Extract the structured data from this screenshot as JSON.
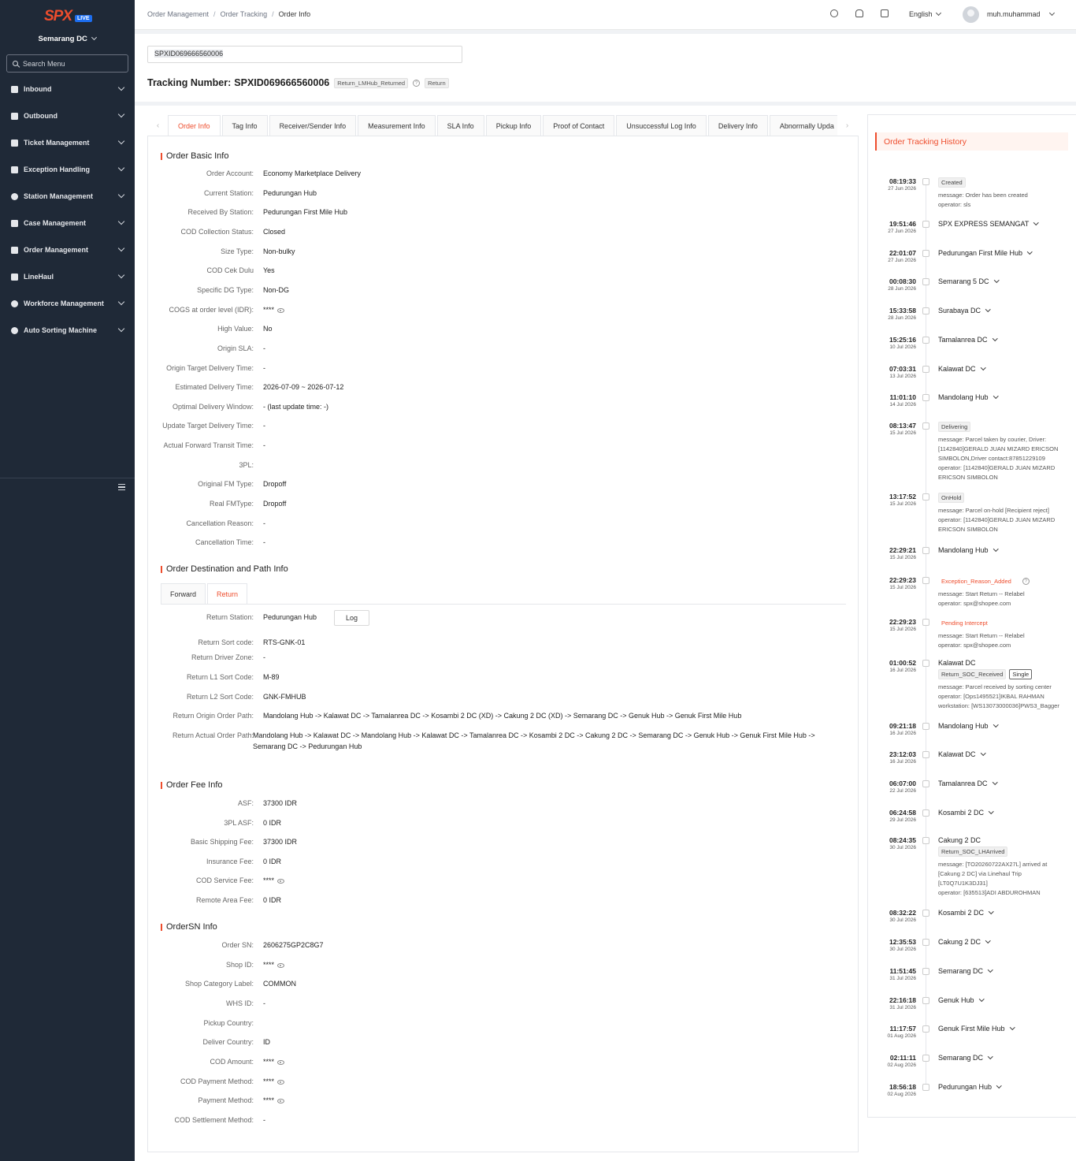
{
  "brand": {
    "logo": "SPX",
    "badge": "LIVE"
  },
  "sidebar": {
    "station": "Semarang DC",
    "search_placeholder": "Search Menu",
    "items": [
      {
        "label": "Inbound"
      },
      {
        "label": "Outbound"
      },
      {
        "label": "Ticket Management"
      },
      {
        "label": "Exception Handling"
      },
      {
        "label": "Station Management"
      },
      {
        "label": "Case Management"
      },
      {
        "label": "Order Management"
      },
      {
        "label": "LineHaul"
      },
      {
        "label": "Workforce Management"
      },
      {
        "label": "Auto Sorting Machine"
      }
    ]
  },
  "topbar": {
    "breadcrumb": [
      "Order Management",
      "Order Tracking",
      "Order Info"
    ],
    "language": "English",
    "username": "muh.muhammad"
  },
  "header": {
    "tracking_input": "SPXID069666560006",
    "title_prefix": "Tracking Number:",
    "tracking_number": "SPXID069666560006",
    "tag_status": "Return_LMHub_Returned",
    "tag_type": "Return"
  },
  "tabs": [
    "Order Info",
    "Tag Info",
    "Receiver/Sender Info",
    "Measurement Info",
    "SLA Info",
    "Pickup Info",
    "Proof of Contact",
    "Unsuccessful Log Info",
    "Delivery Info",
    "Abnormally Upda"
  ],
  "basic_info": {
    "title": "Order Basic Info",
    "rows": [
      {
        "label": "Order Account:",
        "value": "Economy Marketplace Delivery"
      },
      {
        "label": "Current Station:",
        "value": "Pedurungan Hub"
      },
      {
        "label": "Received By Station:",
        "value": "Pedurungan First Mile Hub"
      },
      {
        "label": "COD Collection Status:",
        "value": "Closed"
      },
      {
        "label": "Size Type:",
        "value": "Non-bulky"
      },
      {
        "label": "COD Cek Dulu",
        "value": "Yes"
      },
      {
        "label": "Specific DG Type:",
        "value": "Non-DG"
      },
      {
        "label": "COGS at order level (IDR):",
        "value": "****"
      },
      {
        "label": "High Value:",
        "value": "No"
      },
      {
        "label": "Origin SLA:",
        "value": "-"
      },
      {
        "label": "Origin Target Delivery Time:",
        "value": "-"
      },
      {
        "label": "Estimated Delivery Time:",
        "value": "2026-07-09 ~ 2026-07-12"
      },
      {
        "label": "Optimal Delivery Window:",
        "value": "- (last update time: -)"
      },
      {
        "label": "Update Target Delivery Time:",
        "value": "-"
      },
      {
        "label": "Actual Forward Transit Time:",
        "value": "-"
      },
      {
        "label": "3PL:",
        "value": ""
      },
      {
        "label": "Original FM Type:",
        "value": "Dropoff"
      },
      {
        "label": "Real FMType:",
        "value": "Dropoff"
      },
      {
        "label": "Cancellation Reason:",
        "value": "-"
      },
      {
        "label": "Cancellation Time:",
        "value": "-"
      }
    ]
  },
  "path_info": {
    "title": "Order Destination and Path Info",
    "tabs": [
      "Forward",
      "Return"
    ],
    "log_button": "Log",
    "rows": [
      {
        "label": "Return Station:",
        "value": "Pedurungan Hub"
      },
      {
        "label": "Return Sort code:",
        "value": "RTS-GNK-01"
      },
      {
        "label": "Return Driver Zone:",
        "value": "-"
      },
      {
        "label": "Return L1 Sort Code:",
        "value": "M-89"
      },
      {
        "label": "Return L2 Sort Code:",
        "value": "GNK-FMHUB"
      },
      {
        "label": "Return Origin Order Path:",
        "value": "Mandolang Hub  -> Kalawat DC  -> Tamalanrea DC  -> Kosambi 2 DC (XD)  -> Cakung 2 DC (XD)  -> Semarang DC  -> Genuk Hub  -> Genuk First Mile Hub"
      },
      {
        "label": "Return Actual Order Path:",
        "value": "Mandolang Hub  -> Kalawat DC  -> Mandolang Hub  -> Kalawat DC  -> Tamalanrea DC  -> Kosambi 2 DC  -> Cakung 2 DC  -> Semarang DC  -> Genuk Hub  -> Genuk First Mile Hub  ->",
        "value2": "Semarang DC  -> Pedurungan Hub"
      }
    ]
  },
  "fee_info": {
    "title": "Order Fee Info",
    "rows": [
      {
        "label": "ASF:",
        "value": "37300 IDR"
      },
      {
        "label": "3PL ASF:",
        "value": "0 IDR"
      },
      {
        "label": "Basic Shipping Fee:",
        "value": "37300 IDR"
      },
      {
        "label": "Insurance Fee:",
        "value": "0 IDR"
      },
      {
        "label": "COD Service Fee:",
        "value": "****"
      },
      {
        "label": "Remote Area Fee:",
        "value": "0 IDR"
      }
    ]
  },
  "sn_info": {
    "title": "OrderSN Info",
    "rows": [
      {
        "label": "Order SN:",
        "value": "2606275GP2C8G7"
      },
      {
        "label": "Shop ID:",
        "value": "****"
      },
      {
        "label": "Shop Category Label:",
        "value": "COMMON"
      },
      {
        "label": "WHS ID:",
        "value": "-"
      },
      {
        "label": "Pickup Country:",
        "value": ""
      },
      {
        "label": "Deliver Country:",
        "value": "ID"
      },
      {
        "label": "COD Amount:",
        "value": "****"
      },
      {
        "label": "COD Payment Method:",
        "value": "****"
      },
      {
        "label": "Payment Method:",
        "value": "****"
      },
      {
        "label": "COD Settlement Method:",
        "value": "-"
      }
    ]
  },
  "history": {
    "title": "Order Tracking History",
    "events": [
      {
        "time": "08:19:33",
        "date": "27 Jun 2026",
        "status": "Created",
        "msg": [
          "message: Order has been created",
          "operator: sls"
        ]
      },
      {
        "time": "19:51:46",
        "date": "27 Jun 2026",
        "loc": "SPX EXPRESS SEMANGAT"
      },
      {
        "time": "22:01:07",
        "date": "27 Jun 2026",
        "loc": "Pedurungan First Mile Hub"
      },
      {
        "time": "00:08:30",
        "date": "28 Jun 2026",
        "loc": "Semarang 5 DC"
      },
      {
        "time": "15:33:58",
        "date": "28 Jun 2026",
        "loc": "Surabaya DC"
      },
      {
        "time": "15:25:16",
        "date": "10 Jul 2026",
        "loc": "Tamalanrea DC"
      },
      {
        "time": "07:03:31",
        "date": "13 Jul 2026",
        "loc": "Kalawat DC"
      },
      {
        "time": "11:01:10",
        "date": "14 Jul 2026",
        "loc": "Mandolang Hub"
      },
      {
        "time": "08:13:47",
        "date": "15 Jul 2026",
        "status": "Delivering",
        "msg": [
          "message: Parcel taken by courier, Driver:",
          "[1142840]GERALD JUAN MIZARD ERICSON",
          "SIMBOLON,Driver contact:87851229109",
          "operator: [1142840]GERALD JUAN MIZARD",
          "ERICSON SIMBOLON"
        ]
      },
      {
        "time": "13:17:52",
        "date": "15 Jul 2026",
        "status": "OnHold",
        "msg": [
          "message: Parcel on-hold [Recipient reject]",
          "operator: [1142840]GERALD JUAN MIZARD",
          "ERICSON SIMBOLON"
        ]
      },
      {
        "time": "22:29:21",
        "date": "15 Jul 2026",
        "loc": "Mandolang Hub"
      },
      {
        "time": "22:29:23",
        "date": "15 Jul 2026",
        "status": "Exception_Reason_Added",
        "red": true,
        "msg": [
          "message: Start Return -- Relabel",
          "operator: spx@shopee.com"
        ]
      },
      {
        "time": "22:29:23",
        "date": "15 Jul 2026",
        "status": "Pending Intercept",
        "red": true,
        "msg": [
          "message: Start Return -- Relabel",
          "operator: spx@shopee.com"
        ]
      },
      {
        "time": "01:00:52",
        "date": "16 Jul 2026",
        "title": "Kalawat DC",
        "status": "Return_SOC_Received",
        "extra": "Single",
        "msg": [
          "message: Parcel received by sorting center",
          "operator: [Ops1495521]IKBAL RAHMAN",
          "workstation: [WS13073000036]PWS3_Bagger"
        ]
      },
      {
        "time": "09:21:18",
        "date": "16 Jul 2026",
        "loc": "Mandolang Hub"
      },
      {
        "time": "23:12:03",
        "date": "16 Jul 2026",
        "loc": "Kalawat DC"
      },
      {
        "time": "06:07:00",
        "date": "22 Jul 2026",
        "loc": "Tamalanrea DC"
      },
      {
        "time": "06:24:58",
        "date": "29 Jul 2026",
        "loc": "Kosambi 2 DC"
      },
      {
        "time": "08:24:35",
        "date": "30 Jul 2026",
        "title": "Cakung 2 DC",
        "status": "Return_SOC_LHArrived",
        "msg": [
          "message: [TO20260722AX27L] arrived at",
          "[Cakung 2 DC] via Linehaul Trip",
          "[LT0Q7U1K3DJ31]",
          "operator: [635513]ADI ABDUROHMAN"
        ]
      },
      {
        "time": "08:32:22",
        "date": "30 Jul 2026",
        "loc": "Kosambi 2 DC"
      },
      {
        "time": "12:35:53",
        "date": "30 Jul 2026",
        "loc": "Cakung 2 DC"
      },
      {
        "time": "11:51:45",
        "date": "31 Jul 2026",
        "loc": "Semarang DC"
      },
      {
        "time": "22:16:18",
        "date": "31 Jul 2026",
        "loc": "Genuk Hub"
      },
      {
        "time": "11:17:57",
        "date": "01 Aug 2026",
        "loc": "Genuk First Mile Hub"
      },
      {
        "time": "02:11:11",
        "date": "02 Aug 2026",
        "loc": "Semarang DC"
      },
      {
        "time": "18:56:18",
        "date": "02 Aug 2026",
        "loc": "Pedurungan Hub"
      }
    ]
  }
}
